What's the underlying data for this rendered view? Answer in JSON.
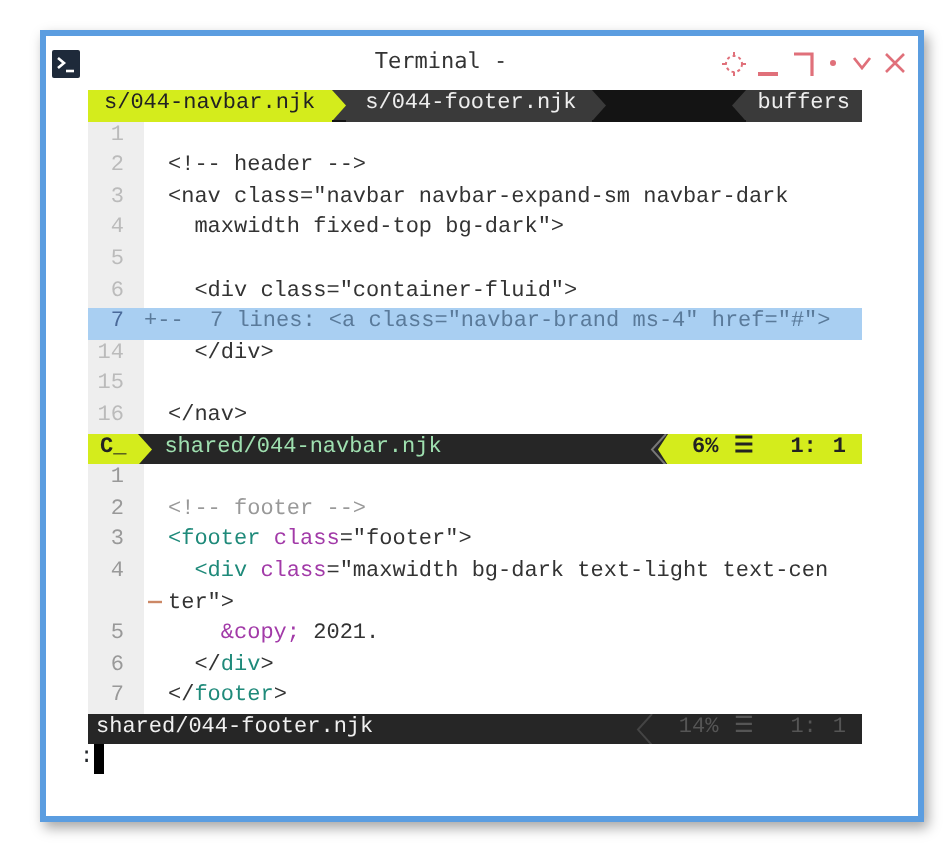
{
  "window": {
    "title": "Terminal -"
  },
  "tabline": {
    "tabs": [
      {
        "label": "s/044-navbar.njk",
        "selected": true
      },
      {
        "label": "s/044-footer.njk",
        "selected": false
      }
    ],
    "buffers_label": "buffers"
  },
  "panes": [
    {
      "active": true,
      "lines": [
        {
          "kind": "code",
          "number": "1"
        },
        {
          "kind": "code",
          "number": "2",
          "tokens": [
            {
              "kind": "text",
              "text": "<!-- header -->"
            }
          ]
        },
        {
          "kind": "code",
          "number": "3",
          "tokens": [
            {
              "kind": "text",
              "text": "<nav class=\"navbar navbar-expand-sm navbar-dark"
            }
          ]
        },
        {
          "kind": "code",
          "number": "4",
          "tokens": [
            {
              "kind": "text",
              "text": "  maxwidth fixed-top bg-dark\">"
            }
          ]
        },
        {
          "kind": "code",
          "number": "5"
        },
        {
          "kind": "code",
          "number": "6",
          "tokens": [
            {
              "kind": "text",
              "text": "  <div class=\"container-fluid\">"
            }
          ]
        },
        {
          "kind": "fold",
          "number": "7",
          "text": "+--  7 lines: <a class=\"navbar-brand ms-4\" href=\"#\">"
        },
        {
          "kind": "code",
          "number": "14",
          "tokens": [
            {
              "kind": "text",
              "text": "  </div>"
            }
          ]
        },
        {
          "kind": "code",
          "number": "15"
        },
        {
          "kind": "code",
          "number": "16",
          "tokens": [
            {
              "kind": "text",
              "text": "</nav>"
            }
          ]
        }
      ],
      "statusline": {
        "mode": "C_",
        "file": "shared/044-navbar.njk",
        "percent": "6%",
        "line_icon": "☰",
        "line": "1:",
        "column": "1"
      }
    },
    {
      "active": false,
      "lines": [
        {
          "kind": "code",
          "number": "1"
        },
        {
          "kind": "code",
          "number": "2",
          "tokens": [
            {
              "kind": "comment",
              "text": "<!-- footer -->"
            }
          ]
        },
        {
          "kind": "code",
          "number": "3",
          "tokens": [
            {
              "kind": "tag",
              "text": "<footer"
            },
            {
              "kind": "attr",
              "text": " class"
            },
            {
              "kind": "text",
              "text": "=\"footer\">"
            }
          ]
        },
        {
          "kind": "code",
          "number": "4",
          "tokens": [
            {
              "kind": "tag",
              "text": "  <div"
            },
            {
              "kind": "attr",
              "text": " class"
            },
            {
              "kind": "text",
              "text": "=\"maxwidth bg-dark text-light text-cen"
            }
          ]
        },
        {
          "kind": "wrap",
          "tokens": [
            {
              "kind": "text",
              "text": "ter\">"
            }
          ]
        },
        {
          "kind": "code",
          "number": "5",
          "tokens": [
            {
              "kind": "attr",
              "text": "    &copy;"
            },
            {
              "kind": "text",
              "text": " 2021."
            }
          ]
        },
        {
          "kind": "code",
          "number": "6",
          "tokens": [
            {
              "kind": "text",
              "text": "  </"
            },
            {
              "kind": "tag",
              "text": "div"
            },
            {
              "kind": "text",
              "text": ">"
            }
          ]
        },
        {
          "kind": "code",
          "number": "7",
          "tokens": [
            {
              "kind": "text",
              "text": "</"
            },
            {
              "kind": "tag",
              "text": "footer"
            },
            {
              "kind": "text",
              "text": ">"
            }
          ]
        }
      ],
      "statusline": {
        "file": "shared/044-footer.njk",
        "percent": "14%",
        "line_icon": "☰",
        "line": "1:",
        "column": "1"
      }
    }
  ],
  "cmdline": {
    "text": ":"
  }
}
